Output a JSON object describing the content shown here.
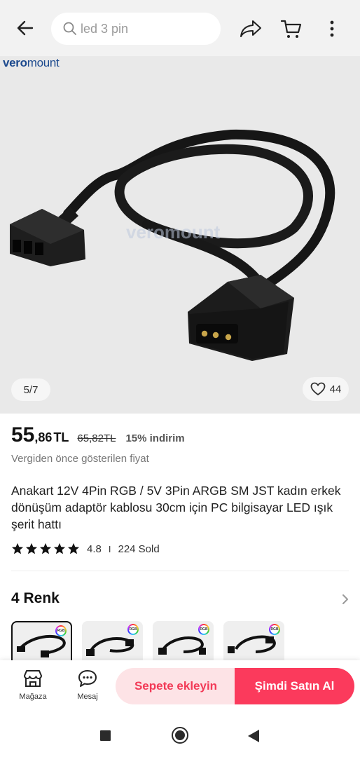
{
  "header": {
    "search_placeholder": "led 3 pin",
    "icons": [
      "arrow-left-icon",
      "search-icon",
      "share-icon",
      "cart-icon",
      "more-vertical-icon"
    ]
  },
  "gallery": {
    "brand_logo_part1": "vero",
    "brand_logo_part2": "mount",
    "watermark": "veromount",
    "page_indicator": "5/7",
    "like_count": "44"
  },
  "price": {
    "integer": "55",
    "decimal": ",86",
    "currency": "TL",
    "old_price": "65,82TL",
    "discount": "15% indirim",
    "tax_note": "Vergiden önce gösterilen fiyat"
  },
  "product": {
    "title": "Anakart 12V 4Pin RGB / 5V 3Pin ARGB SM JST kadın erkek dönüşüm adaptör kablosu 30cm için PC bilgisayar LED ışık şerit hattı",
    "rating": "4.8",
    "rating_stars": 5,
    "separator": "I",
    "sold": "224 Sold"
  },
  "colors": {
    "heading": "4 Renk",
    "thumb_badge": "RGB",
    "selected_index": 0
  },
  "bottom_bar": {
    "store_label": "Mağaza",
    "message_label": "Mesaj",
    "add_to_cart": "Sepete ekleyin",
    "buy_now": "Şimdi Satın Al"
  },
  "theme": {
    "accent": "#fb3a5c",
    "accent_light": "#fde3e6",
    "brand_blue": "#1d4a8e"
  }
}
